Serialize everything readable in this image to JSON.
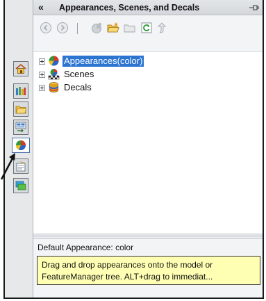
{
  "header": {
    "collapse_label": "«",
    "title": "Appearances, Scenes, and Decals"
  },
  "toolbar": {
    "icons": [
      "back-icon",
      "forward-icon",
      "appearance-add-icon",
      "open-folder-icon",
      "folder-icon",
      "refresh-icon",
      "move-up-icon"
    ]
  },
  "tabs": [
    "home-icon",
    "library-icon",
    "file-explorer-icon",
    "view-palette-icon",
    "appearances-scenes-decals-icon",
    "custom-properties-icon",
    "solidworks-forum-icon"
  ],
  "tree": {
    "items": [
      {
        "label": "Appearances(color)",
        "selected": true
      },
      {
        "label": "Scenes",
        "selected": false
      },
      {
        "label": "Decals",
        "selected": false
      }
    ]
  },
  "status": {
    "text": "Default Appearance: color"
  },
  "tooltip": {
    "line1": "Drag and drop appearances onto the model or",
    "line2": "FeatureManager tree.  ALT+drag to immediat..."
  },
  "colors": {
    "selection": "#2b74d0",
    "tooltip_bg": "#ffffb4"
  }
}
